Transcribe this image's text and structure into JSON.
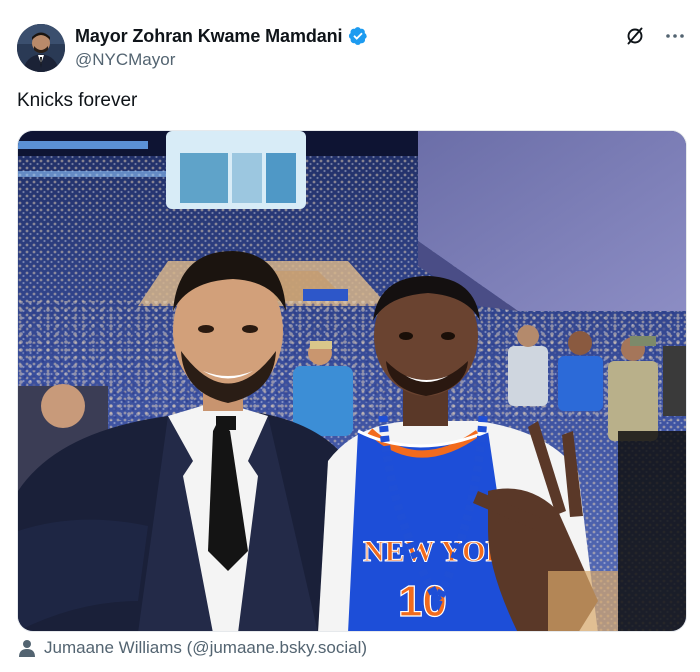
{
  "post": {
    "author": {
      "display_name": "Mayor Zohran Kwame Mamdani",
      "handle": "@NYCMayor",
      "verified": true,
      "avatar_icon": "profile-photo"
    },
    "text": "Knicks forever",
    "actions": {
      "grok_icon": "slashed-circle-icon",
      "more_icon": "more-horizontal-icon"
    },
    "media": {
      "photo_icon": "photo",
      "credit": "Jumaane Williams (@jumaane.bsky.social)",
      "credit_icon": "person-icon"
    }
  },
  "colors": {
    "verified_blue": "#1d9bf0",
    "secondary_text": "#536471",
    "primary_text": "#0f1419",
    "knicks_blue": "#1d4ed8",
    "knicks_orange": "#f26b1d"
  }
}
